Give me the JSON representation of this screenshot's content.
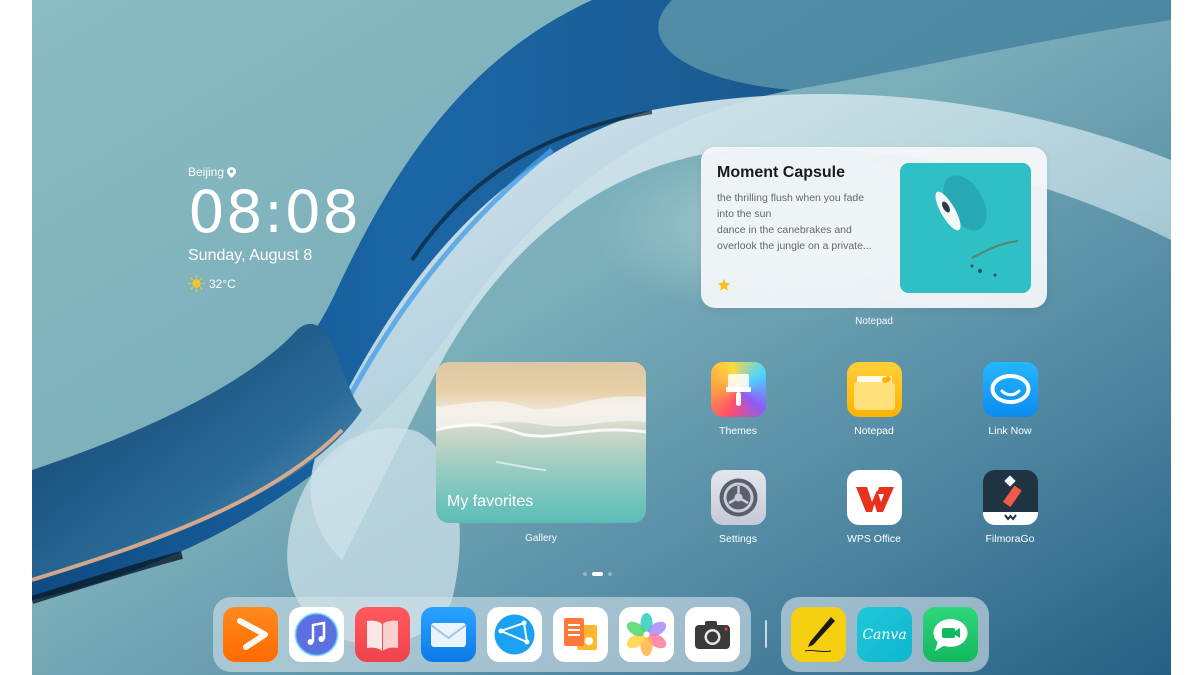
{
  "clock": {
    "city": "Beijing",
    "time": "08:08",
    "date": "Sunday, August 8",
    "temperature": "32°C",
    "weather_icon": "sun-icon"
  },
  "moment_capsule": {
    "title": "Moment Capsule",
    "body_lines": [
      "the thrilling flush when you fade",
      "into the sun",
      "dance in the canebrakes and",
      "overlook the jungle on a private..."
    ],
    "favorite_icon": "star-icon",
    "app_label": "Notepad"
  },
  "gallery_widget": {
    "caption": "My favorites",
    "app_label": "Gallery"
  },
  "apps": [
    {
      "label": "Themes",
      "icon": "themes-brush-icon"
    },
    {
      "label": "Notepad",
      "icon": "notepad-folder-icon"
    },
    {
      "label": "Link Now",
      "icon": "link-now-chat-icon"
    },
    {
      "label": "Settings",
      "icon": "settings-gear-icon"
    },
    {
      "label": "WPS Office",
      "icon": "wps-office-icon"
    },
    {
      "label": "FilmoraGo",
      "icon": "filmorago-icon"
    }
  ],
  "pager": {
    "pages": 3,
    "current_page": 2
  },
  "dock": {
    "main": [
      {
        "name": "Huawei Video",
        "icon": "video-play-icon"
      },
      {
        "name": "Music",
        "icon": "music-note-icon"
      },
      {
        "name": "Books",
        "icon": "open-book-icon"
      },
      {
        "name": "Email",
        "icon": "mail-envelope-icon"
      },
      {
        "name": "Browser",
        "icon": "browser-globe-icon"
      },
      {
        "name": "Docs",
        "icon": "documents-icon"
      },
      {
        "name": "Gallery",
        "icon": "gallery-petals-icon"
      },
      {
        "name": "Camera",
        "icon": "camera-icon"
      }
    ],
    "recent": [
      {
        "name": "Notes Writer",
        "icon": "pen-icon"
      },
      {
        "name": "Canva",
        "icon": "canva-icon",
        "text": "Canva"
      },
      {
        "name": "MeeTime",
        "icon": "video-call-bubble-icon"
      }
    ]
  },
  "colors": {
    "wallpaper_teal": "#7fb0bb",
    "wallpaper_deep_blue": "#1f5f8f",
    "dock_bg": "#c9dbe3",
    "capsule_bg": "#f5f8fa",
    "star_yellow": "#f6c21b"
  }
}
